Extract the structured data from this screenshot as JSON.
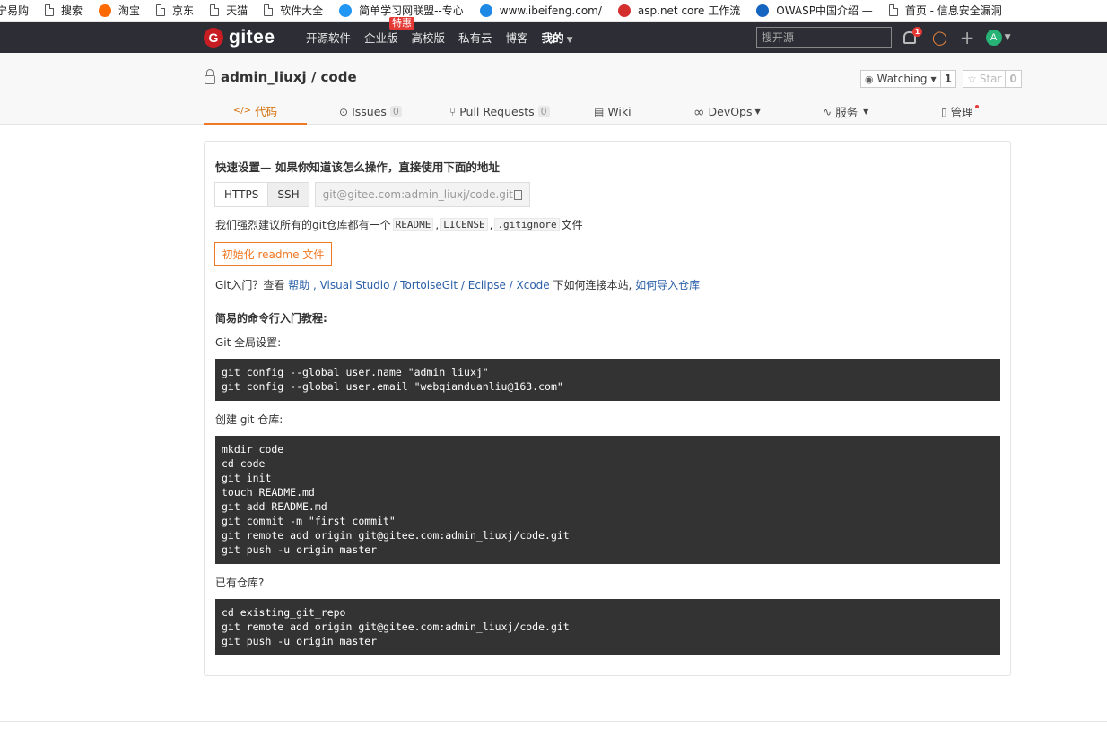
{
  "bookmarks": [
    {
      "label": "宁易购",
      "icon": "page-icon",
      "color": ""
    },
    {
      "label": "搜索",
      "icon": "page-icon",
      "color": ""
    },
    {
      "label": "淘宝",
      "icon": "taobao-icon",
      "color": "#ff6a00"
    },
    {
      "label": "京东",
      "icon": "page-icon",
      "color": ""
    },
    {
      "label": "天猫",
      "icon": "page-icon",
      "color": ""
    },
    {
      "label": "软件大全",
      "icon": "page-icon",
      "color": ""
    },
    {
      "label": "简单学习网联盟--专心",
      "icon": "jdxx-icon",
      "color": "#2196f3"
    },
    {
      "label": "www.ibeifeng.com/",
      "icon": "ibeifeng-icon",
      "color": "#1e88e5"
    },
    {
      "label": "asp.net core 工作流",
      "icon": "pin-icon",
      "color": "#d32f2f"
    },
    {
      "label": "OWASP中国介绍 —",
      "icon": "owasp-icon",
      "color": "#1565c0"
    },
    {
      "label": "首页 - 信息安全漏洞",
      "icon": "page-icon",
      "color": ""
    }
  ],
  "topnav": {
    "logo_mark": "G",
    "logo_text": "gitee",
    "links": [
      "开源软件",
      "企业版",
      "高校版",
      "私有云",
      "博客",
      "我的"
    ],
    "hot_badge": "特惠",
    "search_placeholder": "搜开源",
    "notification_count": "1",
    "avatar_letter": "A"
  },
  "repo": {
    "owner": "admin_liuxj",
    "separator": " / ",
    "name": "code",
    "watch_label": "Watching",
    "watch_count": "1",
    "star_label": "Star",
    "star_count": "0"
  },
  "tabs": [
    {
      "label": "代码",
      "icon": "</>",
      "badge": ""
    },
    {
      "label": "Issues",
      "icon": "",
      "badge": "0"
    },
    {
      "label": "Pull Requests",
      "icon": "",
      "badge": "0"
    },
    {
      "label": "Wiki",
      "icon": "",
      "badge": ""
    },
    {
      "label": "DevOps",
      "icon": "",
      "badge": ""
    },
    {
      "label": "服务",
      "icon": "",
      "badge": ""
    },
    {
      "label": "管理",
      "icon": "",
      "badge": ""
    }
  ],
  "quick_setup": {
    "title": "快速设置— 如果你知道该怎么操作，直接使用下面的地址",
    "https": "HTTPS",
    "ssh": "SSH",
    "clone_url": "git@gitee.com:admin_liuxj/code.git",
    "suggest_prefix": "我们强烈建议所有的git仓库都有一个",
    "file_readme": "README",
    "file_license": "LICENSE",
    "file_gitignore": ".gitignore",
    "comma": ",",
    "suggest_suffix": "文件",
    "init_button": "初始化 readme 文件",
    "help_prefix": "Git入门？查看 ",
    "help_link": "帮助",
    "help_tools": " , Visual Studio / TortoiseGit / Eclipse / Xcode",
    "help_middle": " 下如何连接本站, ",
    "help_import": "如何导入仓库"
  },
  "tutorial": {
    "title": "简易的命令行入门教程:",
    "global_label": "Git 全局设置:",
    "global_code": [
      "git config --global user.name \"admin_liuxj\"",
      "git config --global user.email \"webqianduanliu@163.com\""
    ],
    "create_label": "创建 git 仓库:",
    "create_code": [
      "mkdir code",
      "cd code",
      "git init",
      "touch README.md",
      "git add README.md",
      "git commit -m \"first commit\"",
      "git remote add origin git@gitee.com:admin_liuxj/code.git",
      "git push -u origin master"
    ],
    "existing_label": "已有仓库?",
    "existing_code": [
      "cd existing_git_repo",
      "git remote add origin git@gitee.com:admin_liuxj/code.git",
      "git push -u origin master"
    ]
  }
}
